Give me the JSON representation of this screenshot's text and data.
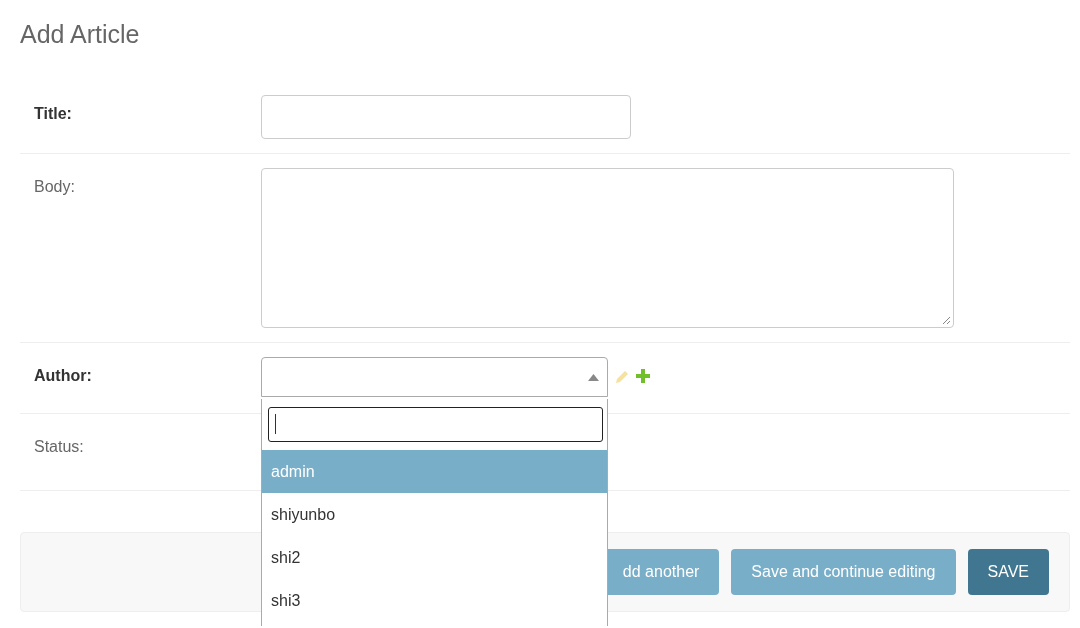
{
  "page_title": "Add Article",
  "fields": [
    {
      "label": "Title:",
      "required": true,
      "kind": "text"
    },
    {
      "label": "Body:",
      "required": false,
      "kind": "textarea"
    },
    {
      "label": "Author:",
      "required": true,
      "kind": "select",
      "expanded": true,
      "change_disabled": true,
      "options": [
        {
          "label": "admin",
          "selected": true
        },
        {
          "label": "shiyunbo",
          "selected": false
        },
        {
          "label": "shi2",
          "selected": false
        },
        {
          "label": "shi3",
          "selected": false
        }
      ]
    },
    {
      "label": "Status:",
      "required": false,
      "kind": "hidden"
    }
  ],
  "buttons": [
    {
      "label": "dd another",
      "kind": "secondary"
    },
    {
      "label": "Save and continue editing",
      "kind": "secondary"
    },
    {
      "label": "SAVE",
      "kind": "primary"
    }
  ]
}
